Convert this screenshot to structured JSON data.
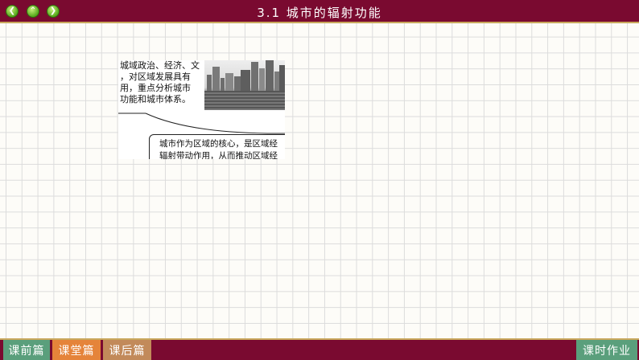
{
  "header": {
    "title": "3.1 城市的辐射功能",
    "nav": [
      "back-icon",
      "up-icon",
      "forward-icon"
    ],
    "background": "#7a0a30"
  },
  "content": {
    "top_text_lines": [
      "城域政治、经济、文",
      "，对区域发展具有",
      "用，重点分析城市",
      "功能和城市体系。"
    ],
    "box_text_lines": [
      "城市作为区域的核心，是区域经",
      "辐射带动作用，从而推动区域经"
    ]
  },
  "footer": {
    "tabs": [
      {
        "label": "课前篇",
        "color": "#5a9f7c"
      },
      {
        "label": "课堂篇",
        "color": "#e5843a"
      },
      {
        "label": "课后篇",
        "color": "#c28a5a"
      }
    ],
    "homework_label": "课时作业",
    "homework_color": "#5a9f7c"
  }
}
